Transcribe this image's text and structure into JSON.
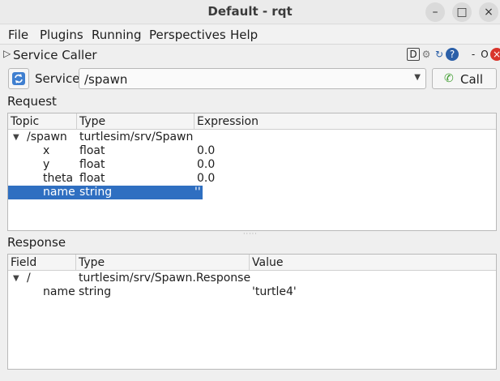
{
  "window": {
    "title": "Default - rqt",
    "minimize": "–",
    "maximize": "□",
    "close": "×"
  },
  "menubar": {
    "items": [
      {
        "label": "File"
      },
      {
        "label": "Plugins"
      },
      {
        "label": "Running"
      },
      {
        "label": "Perspectives"
      },
      {
        "label": "Help"
      }
    ]
  },
  "dock": {
    "title": "Service Caller",
    "icons": {
      "d": "D",
      "gear": "⚙",
      "reload": "↻",
      "help": "?",
      "min": "-",
      "o": "O",
      "close": "×"
    }
  },
  "service": {
    "label": "Service",
    "value": "/spawn",
    "call_label": "Call"
  },
  "request": {
    "label": "Request",
    "columns": [
      "Topic",
      "Type",
      "Expression"
    ],
    "rows": [
      {
        "topic": "/spawn",
        "type": "turtlesim/srv/Spawn",
        "expr": ""
      },
      {
        "topic": "x",
        "type": "float",
        "expr": "0.0"
      },
      {
        "topic": "y",
        "type": "float",
        "expr": "0.0"
      },
      {
        "topic": "theta",
        "type": "float",
        "expr": "0.0"
      },
      {
        "topic": "name",
        "type": "string",
        "expr": "''"
      }
    ]
  },
  "response": {
    "label": "Response",
    "columns": [
      "Field",
      "Type",
      "Value"
    ],
    "rows": [
      {
        "field": "/",
        "type": "turtlesim/srv/Spawn.Response",
        "value": ""
      },
      {
        "field": "name",
        "type": "string",
        "value": "'turtle4'"
      }
    ]
  },
  "colors": {
    "selection": "#2f6fc1",
    "call_icon": "#3a9a2a"
  }
}
